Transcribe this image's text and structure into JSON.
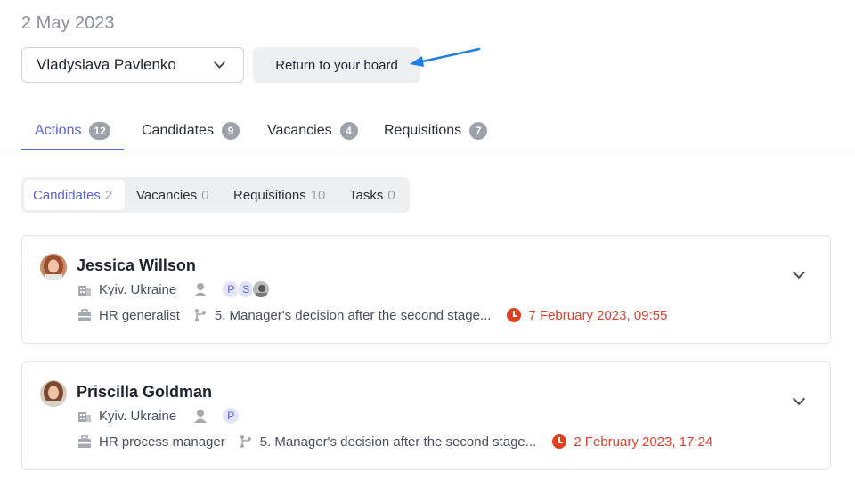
{
  "header": {
    "date": "2 May 2023",
    "user_select": "Vladyslava Pavlenko",
    "return_button": "Return to your board"
  },
  "tabs": [
    {
      "label": "Actions",
      "count": "12",
      "active": true
    },
    {
      "label": "Candidates",
      "count": "9"
    },
    {
      "label": "Vacancies",
      "count": "4"
    },
    {
      "label": "Requisitions",
      "count": "7"
    }
  ],
  "subtabs": [
    {
      "label": "Candidates",
      "count": "2",
      "active": true
    },
    {
      "label": "Vacancies",
      "count": "0"
    },
    {
      "label": "Requisitions",
      "count": "10"
    },
    {
      "label": "Tasks",
      "count": "0"
    }
  ],
  "cards": [
    {
      "name": "Jessica Willson",
      "location": "Kyiv. Ukraine",
      "recruiters": [
        "P",
        "S"
      ],
      "position": "HR generalist",
      "stage": "5. Manager's decision after the second stage...",
      "due": "7 February 2023, 09:55"
    },
    {
      "name": "Priscilla Goldman",
      "location": "Kyiv. Ukraine",
      "recruiters": [
        "P"
      ],
      "position": "HR process manager",
      "stage": "5. Manager's decision after the second stage...",
      "due": "2 February 2023, 17:24"
    }
  ],
  "colors": {
    "accent": "#5a63d8",
    "due": "#d9432e",
    "arrow": "#1a7fe8"
  }
}
